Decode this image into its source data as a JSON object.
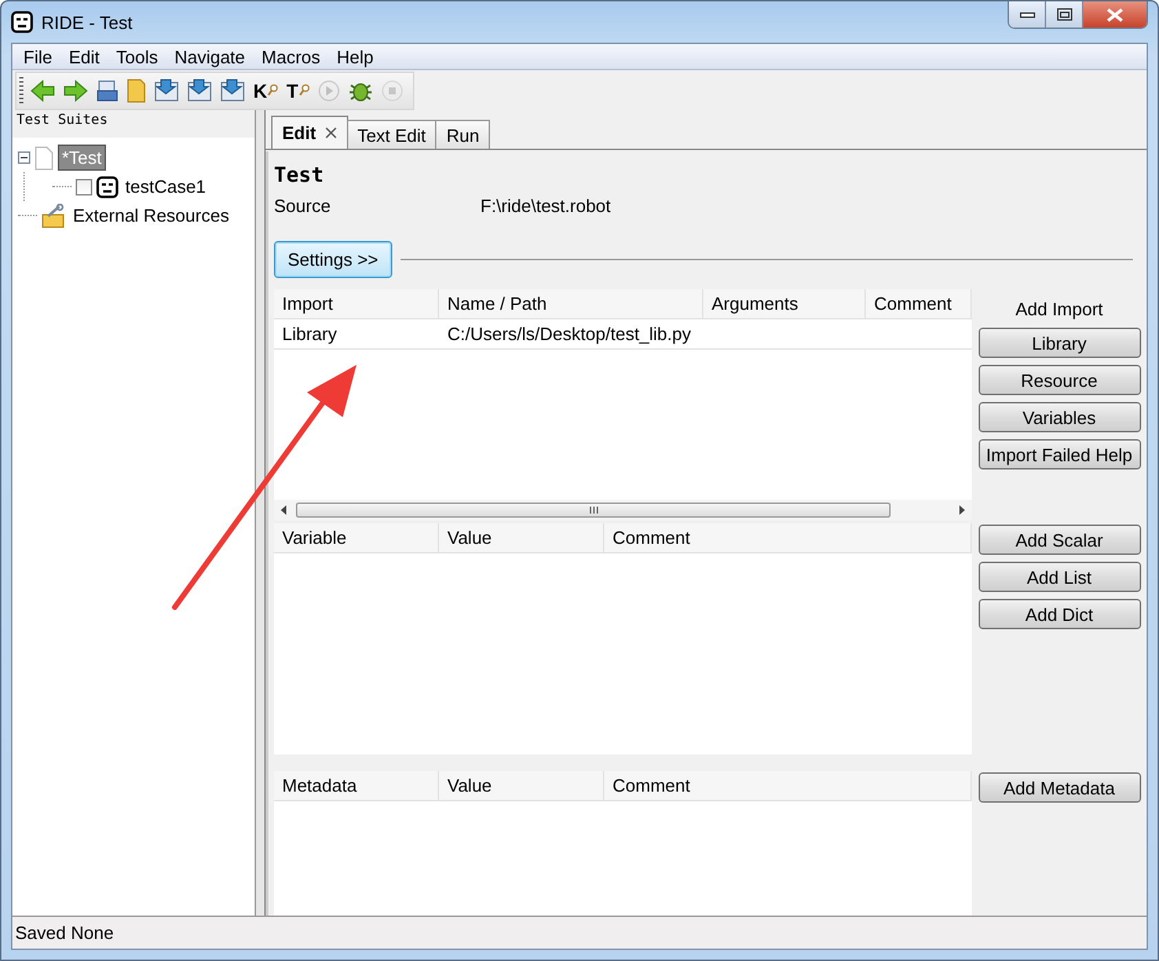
{
  "window": {
    "title": "RIDE - Test"
  },
  "menu": [
    "File",
    "Edit",
    "Tools",
    "Navigate",
    "Macros",
    "Help"
  ],
  "toolbar": [
    {
      "kind": "back",
      "disabled": false
    },
    {
      "kind": "forward",
      "disabled": false
    },
    {
      "kind": "open",
      "disabled": false
    },
    {
      "kind": "folder",
      "disabled": false
    },
    {
      "kind": "save",
      "disabled": false
    },
    {
      "kind": "save",
      "disabled": false
    },
    {
      "kind": "save",
      "disabled": false
    },
    {
      "kind": "search",
      "label": "K",
      "disabled": false
    },
    {
      "kind": "search",
      "label": "T",
      "disabled": false
    },
    {
      "kind": "run",
      "disabled": true
    },
    {
      "kind": "bug",
      "disabled": false
    },
    {
      "kind": "stop",
      "disabled": true
    }
  ],
  "tree_header": "Test Suites",
  "tree": [
    {
      "label": "*Test",
      "kind": "suite",
      "selected": true,
      "expanded": true,
      "children": [
        {
          "label": "testCase1",
          "kind": "test",
          "selected": false,
          "checked": false
        }
      ]
    },
    {
      "label": "External Resources",
      "kind": "resources",
      "selected": false
    }
  ],
  "tabs": [
    {
      "label": "Edit",
      "selected": true,
      "closable": true
    },
    {
      "label": "Text Edit",
      "selected": false,
      "closable": false
    },
    {
      "label": "Run",
      "selected": false,
      "closable": false
    }
  ],
  "editor": {
    "title": "Test",
    "source_label": "Source",
    "source_value": "F:\\ride\\test.robot",
    "settings_button": "Settings >>",
    "imports": {
      "columns": [
        "Import",
        "Name / Path",
        "Arguments",
        "Comment"
      ],
      "rows": [
        [
          "Library",
          "C:/Users/ls/Desktop/test_lib.py"
        ]
      ],
      "side_title": "Add Import",
      "buttons": [
        "Library",
        "Resource",
        "Variables",
        "Import Failed Help"
      ]
    },
    "variables": {
      "columns": [
        "Variable",
        "Value",
        "Comment"
      ],
      "buttons": [
        "Add Scalar",
        "Add List",
        "Add Dict"
      ]
    },
    "metadata": {
      "columns": [
        "Metadata",
        "Value",
        "Comment"
      ],
      "buttons": [
        "Add Metadata"
      ]
    }
  },
  "status_bar": "Saved None"
}
